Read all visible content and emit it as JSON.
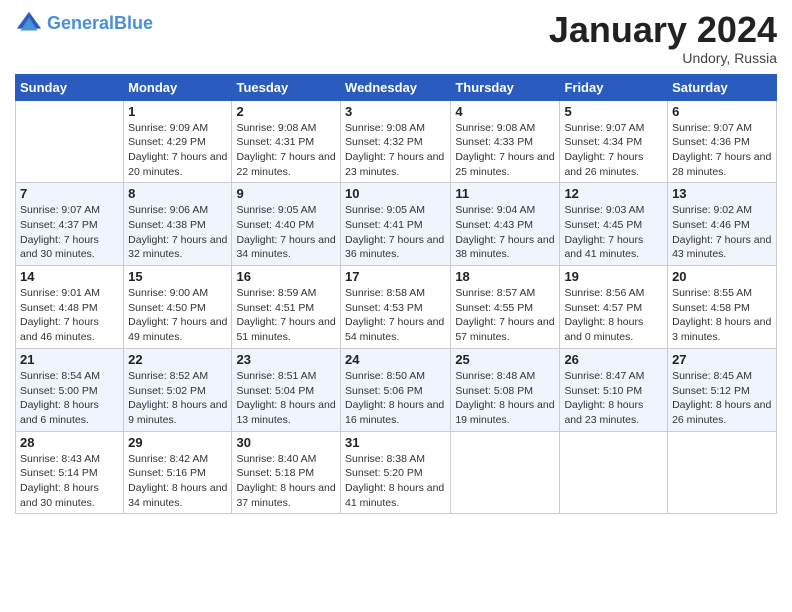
{
  "header": {
    "logo_line1": "General",
    "logo_line2": "Blue",
    "month_title": "January 2024",
    "location": "Undory, Russia"
  },
  "weekdays": [
    "Sunday",
    "Monday",
    "Tuesday",
    "Wednesday",
    "Thursday",
    "Friday",
    "Saturday"
  ],
  "weeks": [
    [
      {
        "day": "",
        "sunrise": "",
        "sunset": "",
        "daylight": ""
      },
      {
        "day": "1",
        "sunrise": "Sunrise: 9:09 AM",
        "sunset": "Sunset: 4:29 PM",
        "daylight": "Daylight: 7 hours and 20 minutes."
      },
      {
        "day": "2",
        "sunrise": "Sunrise: 9:08 AM",
        "sunset": "Sunset: 4:31 PM",
        "daylight": "Daylight: 7 hours and 22 minutes."
      },
      {
        "day": "3",
        "sunrise": "Sunrise: 9:08 AM",
        "sunset": "Sunset: 4:32 PM",
        "daylight": "Daylight: 7 hours and 23 minutes."
      },
      {
        "day": "4",
        "sunrise": "Sunrise: 9:08 AM",
        "sunset": "Sunset: 4:33 PM",
        "daylight": "Daylight: 7 hours and 25 minutes."
      },
      {
        "day": "5",
        "sunrise": "Sunrise: 9:07 AM",
        "sunset": "Sunset: 4:34 PM",
        "daylight": "Daylight: 7 hours and 26 minutes."
      },
      {
        "day": "6",
        "sunrise": "Sunrise: 9:07 AM",
        "sunset": "Sunset: 4:36 PM",
        "daylight": "Daylight: 7 hours and 28 minutes."
      }
    ],
    [
      {
        "day": "7",
        "sunrise": "Sunrise: 9:07 AM",
        "sunset": "Sunset: 4:37 PM",
        "daylight": "Daylight: 7 hours and 30 minutes."
      },
      {
        "day": "8",
        "sunrise": "Sunrise: 9:06 AM",
        "sunset": "Sunset: 4:38 PM",
        "daylight": "Daylight: 7 hours and 32 minutes."
      },
      {
        "day": "9",
        "sunrise": "Sunrise: 9:05 AM",
        "sunset": "Sunset: 4:40 PM",
        "daylight": "Daylight: 7 hours and 34 minutes."
      },
      {
        "day": "10",
        "sunrise": "Sunrise: 9:05 AM",
        "sunset": "Sunset: 4:41 PM",
        "daylight": "Daylight: 7 hours and 36 minutes."
      },
      {
        "day": "11",
        "sunrise": "Sunrise: 9:04 AM",
        "sunset": "Sunset: 4:43 PM",
        "daylight": "Daylight: 7 hours and 38 minutes."
      },
      {
        "day": "12",
        "sunrise": "Sunrise: 9:03 AM",
        "sunset": "Sunset: 4:45 PM",
        "daylight": "Daylight: 7 hours and 41 minutes."
      },
      {
        "day": "13",
        "sunrise": "Sunrise: 9:02 AM",
        "sunset": "Sunset: 4:46 PM",
        "daylight": "Daylight: 7 hours and 43 minutes."
      }
    ],
    [
      {
        "day": "14",
        "sunrise": "Sunrise: 9:01 AM",
        "sunset": "Sunset: 4:48 PM",
        "daylight": "Daylight: 7 hours and 46 minutes."
      },
      {
        "day": "15",
        "sunrise": "Sunrise: 9:00 AM",
        "sunset": "Sunset: 4:50 PM",
        "daylight": "Daylight: 7 hours and 49 minutes."
      },
      {
        "day": "16",
        "sunrise": "Sunrise: 8:59 AM",
        "sunset": "Sunset: 4:51 PM",
        "daylight": "Daylight: 7 hours and 51 minutes."
      },
      {
        "day": "17",
        "sunrise": "Sunrise: 8:58 AM",
        "sunset": "Sunset: 4:53 PM",
        "daylight": "Daylight: 7 hours and 54 minutes."
      },
      {
        "day": "18",
        "sunrise": "Sunrise: 8:57 AM",
        "sunset": "Sunset: 4:55 PM",
        "daylight": "Daylight: 7 hours and 57 minutes."
      },
      {
        "day": "19",
        "sunrise": "Sunrise: 8:56 AM",
        "sunset": "Sunset: 4:57 PM",
        "daylight": "Daylight: 8 hours and 0 minutes."
      },
      {
        "day": "20",
        "sunrise": "Sunrise: 8:55 AM",
        "sunset": "Sunset: 4:58 PM",
        "daylight": "Daylight: 8 hours and 3 minutes."
      }
    ],
    [
      {
        "day": "21",
        "sunrise": "Sunrise: 8:54 AM",
        "sunset": "Sunset: 5:00 PM",
        "daylight": "Daylight: 8 hours and 6 minutes."
      },
      {
        "day": "22",
        "sunrise": "Sunrise: 8:52 AM",
        "sunset": "Sunset: 5:02 PM",
        "daylight": "Daylight: 8 hours and 9 minutes."
      },
      {
        "day": "23",
        "sunrise": "Sunrise: 8:51 AM",
        "sunset": "Sunset: 5:04 PM",
        "daylight": "Daylight: 8 hours and 13 minutes."
      },
      {
        "day": "24",
        "sunrise": "Sunrise: 8:50 AM",
        "sunset": "Sunset: 5:06 PM",
        "daylight": "Daylight: 8 hours and 16 minutes."
      },
      {
        "day": "25",
        "sunrise": "Sunrise: 8:48 AM",
        "sunset": "Sunset: 5:08 PM",
        "daylight": "Daylight: 8 hours and 19 minutes."
      },
      {
        "day": "26",
        "sunrise": "Sunrise: 8:47 AM",
        "sunset": "Sunset: 5:10 PM",
        "daylight": "Daylight: 8 hours and 23 minutes."
      },
      {
        "day": "27",
        "sunrise": "Sunrise: 8:45 AM",
        "sunset": "Sunset: 5:12 PM",
        "daylight": "Daylight: 8 hours and 26 minutes."
      }
    ],
    [
      {
        "day": "28",
        "sunrise": "Sunrise: 8:43 AM",
        "sunset": "Sunset: 5:14 PM",
        "daylight": "Daylight: 8 hours and 30 minutes."
      },
      {
        "day": "29",
        "sunrise": "Sunrise: 8:42 AM",
        "sunset": "Sunset: 5:16 PM",
        "daylight": "Daylight: 8 hours and 34 minutes."
      },
      {
        "day": "30",
        "sunrise": "Sunrise: 8:40 AM",
        "sunset": "Sunset: 5:18 PM",
        "daylight": "Daylight: 8 hours and 37 minutes."
      },
      {
        "day": "31",
        "sunrise": "Sunrise: 8:38 AM",
        "sunset": "Sunset: 5:20 PM",
        "daylight": "Daylight: 8 hours and 41 minutes."
      },
      {
        "day": "",
        "sunrise": "",
        "sunset": "",
        "daylight": ""
      },
      {
        "day": "",
        "sunrise": "",
        "sunset": "",
        "daylight": ""
      },
      {
        "day": "",
        "sunrise": "",
        "sunset": "",
        "daylight": ""
      }
    ]
  ]
}
